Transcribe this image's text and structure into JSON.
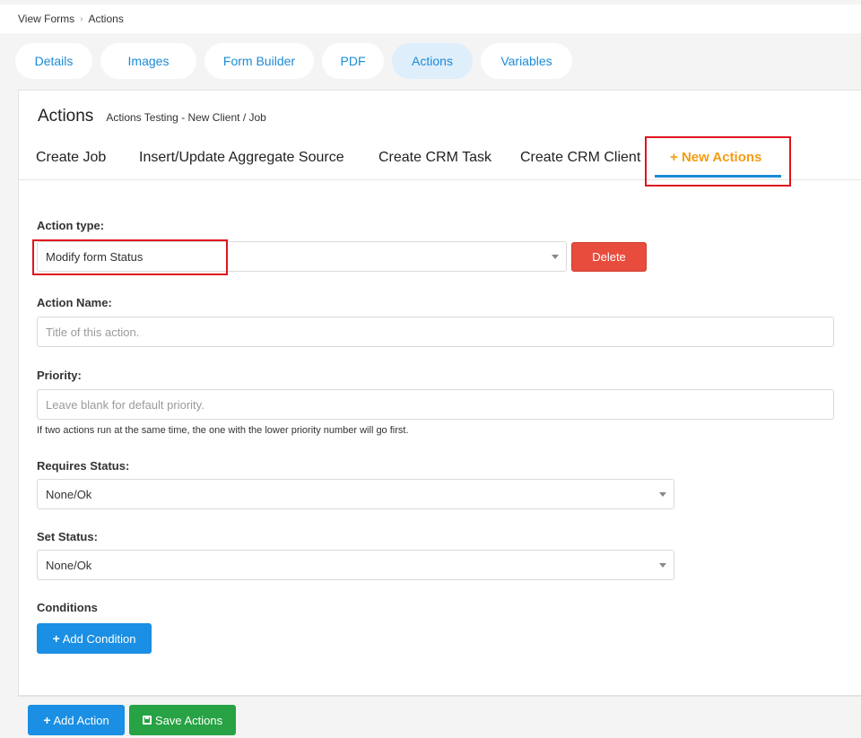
{
  "breadcrumb": {
    "parent": "View Forms",
    "separator": "›",
    "current": "Actions"
  },
  "top_tabs": [
    {
      "label": "Details"
    },
    {
      "label": "Images"
    },
    {
      "label": "Form Builder"
    },
    {
      "label": "PDF"
    },
    {
      "label": "Actions",
      "active": true
    },
    {
      "label": "Variables"
    }
  ],
  "card": {
    "title": "Actions",
    "subtitle": "Actions Testing - New Client / Job"
  },
  "action_tabs": [
    {
      "label": "Create Job"
    },
    {
      "label": "Insert/Update Aggregate Source"
    },
    {
      "label": "Create CRM Task"
    },
    {
      "label": "Create CRM Client"
    }
  ],
  "new_action_tab": {
    "icon": "+",
    "label": "New Actions"
  },
  "form": {
    "action_type_label": "Action type:",
    "action_type_value": "Modify form Status",
    "delete_label": "Delete",
    "action_name_label": "Action Name:",
    "action_name_placeholder": "Title of this action.",
    "priority_label": "Priority:",
    "priority_placeholder": "Leave blank for default priority.",
    "priority_help": "If two actions run at the same time, the one with the lower priority number will go first.",
    "requires_status_label": "Requires Status:",
    "requires_status_value": "None/Ok",
    "set_status_label": "Set Status:",
    "set_status_value": "None/Ok",
    "conditions_label": "Conditions",
    "add_condition_label": "Add Condition"
  },
  "footer": {
    "add_action_label": "Add Action",
    "save_actions_label": "Save Actions"
  },
  "colors": {
    "accent_blue": "#1a8fe3",
    "new_tab_orange": "#f39c12",
    "delete_red": "#e74c3c",
    "save_green": "#27a244",
    "highlight_red": "#e0141e"
  },
  "icons": {
    "plus": "plus-icon",
    "save": "save-icon",
    "dropdown": "caret-down-icon"
  }
}
